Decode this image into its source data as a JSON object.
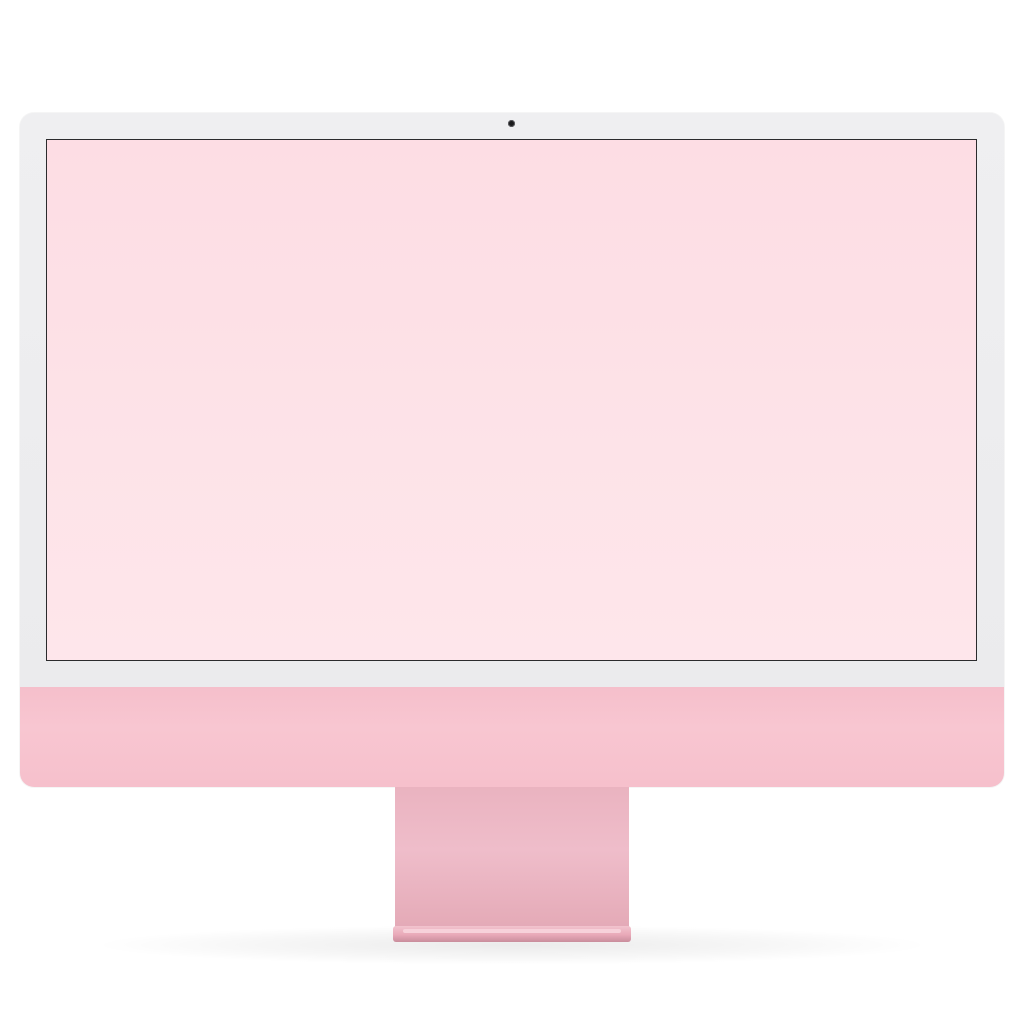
{
  "device": {
    "type": "desktop-computer",
    "screen_state": "blank",
    "colors": {
      "bezel": "#ececee",
      "screen": "#fde1e6",
      "chin": "#f7c3ce",
      "stand": "#ecb5c2",
      "camera": "#1b1b1d"
    }
  }
}
